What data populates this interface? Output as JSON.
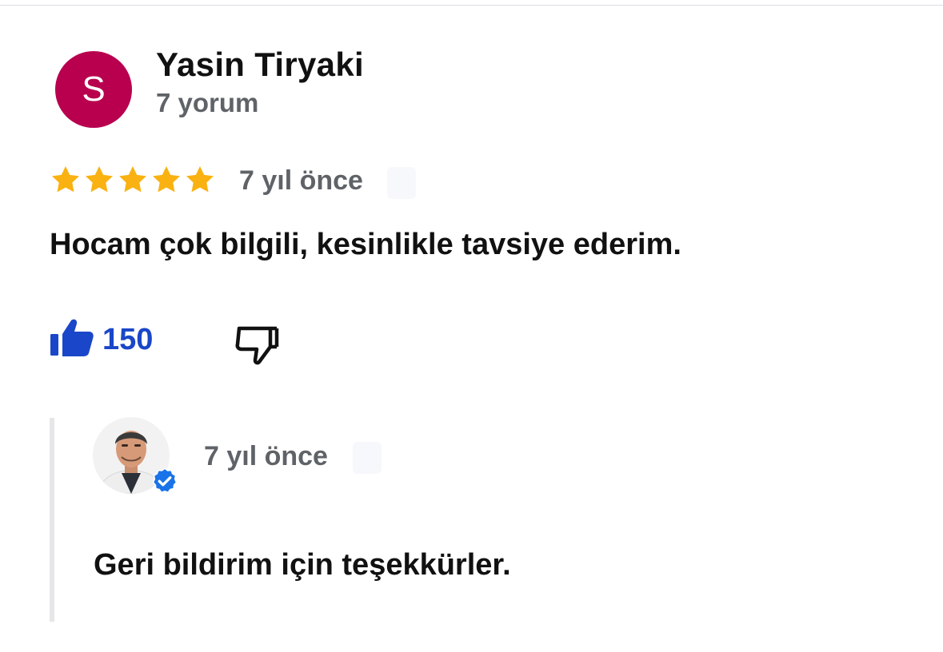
{
  "review": {
    "avatar_letter": "S",
    "avatar_color": "#b8004f",
    "author_name": "Yasin Tiryaki",
    "review_count": "7 yorum",
    "rating": 5,
    "rating_max": 5,
    "star_color": "#f9b211",
    "time": "7 yıl önce",
    "text": "Hocam çok bilgili, kesinlikle tavsiye ederim.",
    "like_count": "150",
    "like_color": "#1a47c9",
    "like_icon": "thumbs-up-icon",
    "dislike_icon": "thumbs-down-icon"
  },
  "reply": {
    "avatar_icon": "owner-photo",
    "verified_icon": "verified-badge-icon",
    "verified_color": "#1a73e8",
    "time": "7 yıl önce",
    "text": "Geri bildirim için teşekkürler."
  }
}
